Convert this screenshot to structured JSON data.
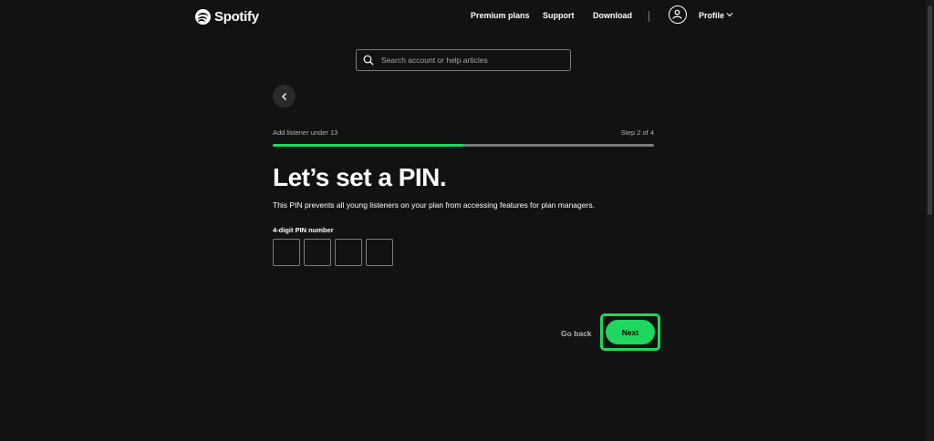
{
  "header": {
    "brand": "Spotify",
    "nav": [
      "Premium plans",
      "Support",
      "Download"
    ],
    "profile_label": "Profile"
  },
  "search": {
    "placeholder": "Search account or help articles"
  },
  "step": {
    "label": "Add listener under 13",
    "count": "Step 2 of 4",
    "progress": 0.5
  },
  "main": {
    "title": "Let’s set a PIN.",
    "description": "This PIN prevents all young listeners on your plan from accessing features for plan managers.",
    "pin_label": "4-digit PIN number",
    "pin_digits": [
      "",
      "",
      "",
      ""
    ]
  },
  "actions": {
    "go_back": "Go back",
    "next": "Next"
  },
  "colors": {
    "background": "#121212",
    "accent": "#1ed760"
  }
}
